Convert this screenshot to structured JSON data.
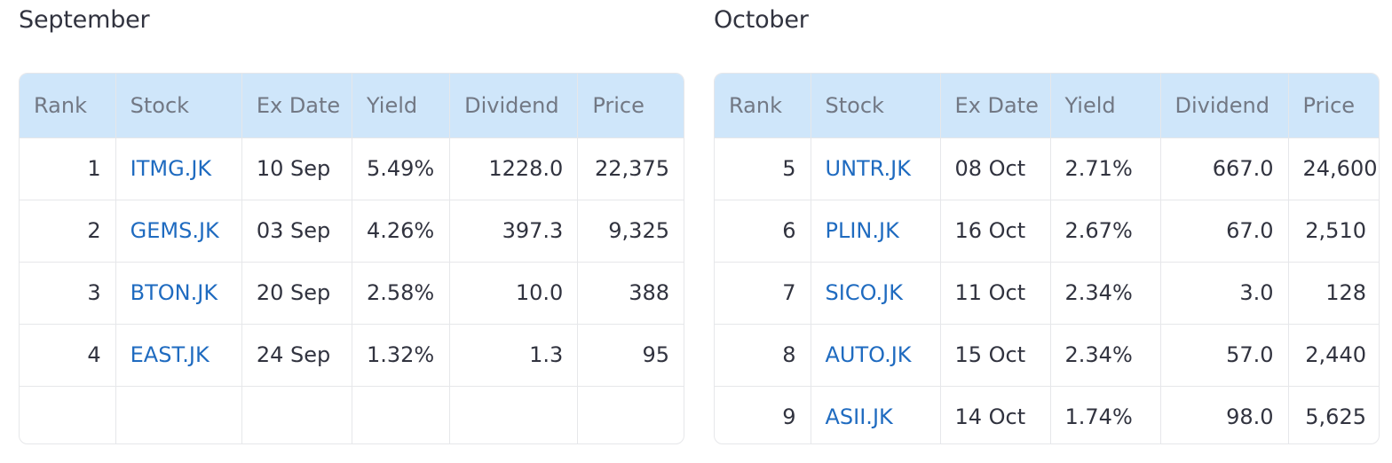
{
  "september": {
    "heading": "September",
    "columns": [
      "Rank",
      "Stock",
      "Ex Date",
      "Yield",
      "Dividend",
      "Price"
    ],
    "rows": [
      {
        "rank": "1",
        "stock": "ITMG.JK",
        "ex_date": "10 Sep",
        "yield": "5.49%",
        "dividend": "1228.0",
        "price": "22,375"
      },
      {
        "rank": "2",
        "stock": "GEMS.JK",
        "ex_date": "03 Sep",
        "yield": "4.26%",
        "dividend": "397.3",
        "price": "9,325"
      },
      {
        "rank": "3",
        "stock": "BTON.JK",
        "ex_date": "20 Sep",
        "yield": "2.58%",
        "dividend": "10.0",
        "price": "388"
      },
      {
        "rank": "4",
        "stock": "EAST.JK",
        "ex_date": "24 Sep",
        "yield": "1.32%",
        "dividend": "1.3",
        "price": "95"
      }
    ]
  },
  "october": {
    "heading": "October",
    "columns": [
      "Rank",
      "Stock",
      "Ex Date",
      "Yield",
      "Dividend",
      "Price"
    ],
    "rows": [
      {
        "rank": "5",
        "stock": "UNTR.JK",
        "ex_date": "08 Oct",
        "yield": "2.71%",
        "dividend": "667.0",
        "price": "24,600"
      },
      {
        "rank": "6",
        "stock": "PLIN.JK",
        "ex_date": "16 Oct",
        "yield": "2.67%",
        "dividend": "67.0",
        "price": "2,510"
      },
      {
        "rank": "7",
        "stock": "SICO.JK",
        "ex_date": "11 Oct",
        "yield": "2.34%",
        "dividend": "3.0",
        "price": "128"
      },
      {
        "rank": "8",
        "stock": "AUTO.JK",
        "ex_date": "15 Oct",
        "yield": "2.34%",
        "dividend": "57.0",
        "price": "2,440"
      },
      {
        "rank": "9",
        "stock": "ASII.JK",
        "ex_date": "14 Oct",
        "yield": "1.74%",
        "dividend": "98.0",
        "price": "5,625"
      }
    ]
  },
  "colors": {
    "header_bg": "#cfe6fa",
    "header_text": "#727884",
    "link": "#1f6bc0",
    "body_text": "#31333f",
    "border": "#e6e7ea"
  }
}
